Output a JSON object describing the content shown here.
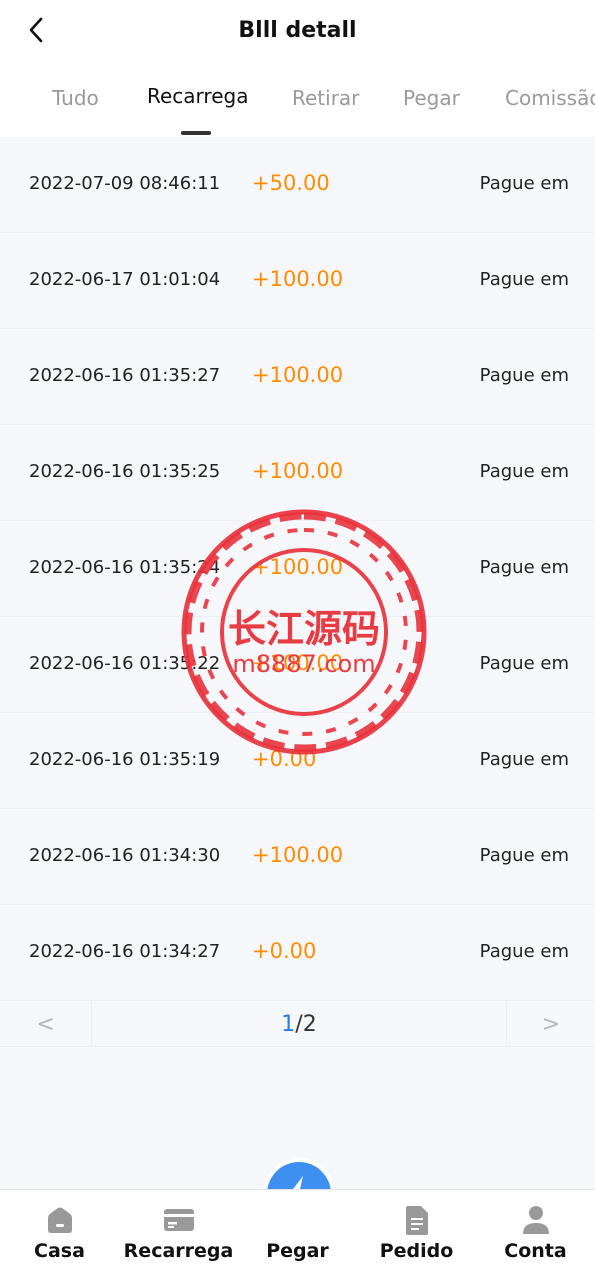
{
  "header": {
    "title": "Blll detall"
  },
  "tabs": [
    {
      "label": "Tudo"
    },
    {
      "label": "Recarrega"
    },
    {
      "label": "Retirar"
    },
    {
      "label": "Pegar"
    },
    {
      "label": "Comissão"
    }
  ],
  "active_tab": "Recarrega",
  "records": [
    {
      "date": "2022-07-09 08:46:11",
      "amount": "+50.00",
      "status": "Pague em"
    },
    {
      "date": "2022-06-17 01:01:04",
      "amount": "+100.00",
      "status": "Pague em"
    },
    {
      "date": "2022-06-16 01:35:27",
      "amount": "+100.00",
      "status": "Pague em"
    },
    {
      "date": "2022-06-16 01:35:25",
      "amount": "+100.00",
      "status": "Pague em"
    },
    {
      "date": "2022-06-16 01:35:24",
      "amount": "+100.00",
      "status": "Pague em"
    },
    {
      "date": "2022-06-16 01:35:22",
      "amount": "+100.00",
      "status": "Pague em"
    },
    {
      "date": "2022-06-16 01:35:19",
      "amount": "+0.00",
      "status": "Pague em"
    },
    {
      "date": "2022-06-16 01:34:30",
      "amount": "+100.00",
      "status": "Pague em"
    },
    {
      "date": "2022-06-16 01:34:27",
      "amount": "+0.00",
      "status": "Pague em"
    }
  ],
  "pagination": {
    "current": "1",
    "separator": "/",
    "total": "2",
    "prev": "<",
    "next": ">"
  },
  "watermark": {
    "title": "长江源码",
    "url": "m8887.com",
    "color": "#e8323c"
  },
  "bottom_nav": [
    {
      "label": "Casa",
      "icon": "home-icon"
    },
    {
      "label": "Recarrega",
      "icon": "card-icon"
    },
    {
      "label": "Pegar",
      "icon": "lightning-icon"
    },
    {
      "label": "Pedido",
      "icon": "document-icon"
    },
    {
      "label": "Conta",
      "icon": "user-icon"
    }
  ],
  "colors": {
    "amount": "#ff8c00",
    "accent": "#3d8ff0",
    "page_current": "#2a7be4"
  }
}
